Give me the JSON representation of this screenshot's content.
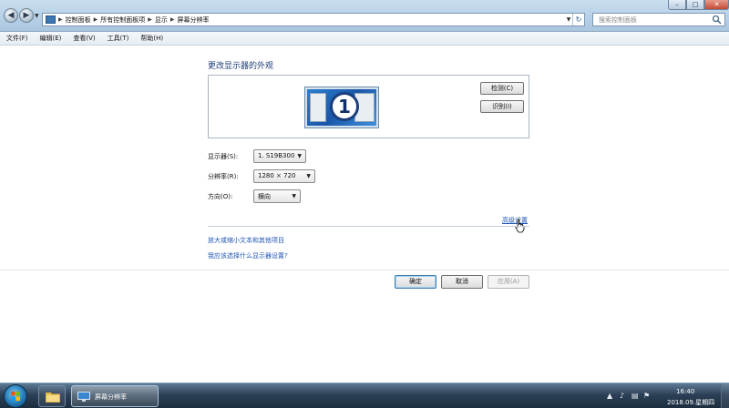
{
  "address_bar": {
    "breadcrumbs": [
      "控制面板",
      "所有控制面板项",
      "显示",
      "屏幕分辨率"
    ]
  },
  "search": {
    "placeholder": "搜索控制面板"
  },
  "menu": {
    "items": [
      "文件(F)",
      "编辑(E)",
      "查看(V)",
      "工具(T)",
      "帮助(H)"
    ]
  },
  "main": {
    "title": "更改显示器的外观",
    "monitor_number": "1",
    "detect_label": "检测(C)",
    "identify_label": "识别(I)",
    "display_label": "显示器(S):",
    "display_value": "1. S19B300",
    "resolution_label": "分辨率(R):",
    "resolution_value": "1280 × 720",
    "orientation_label": "方向(O):",
    "orientation_value": "横向",
    "advanced_link": "高级设置",
    "text_size_link": "放大或缩小文本和其他项目",
    "which_settings_link": "我应该选择什么显示器设置?"
  },
  "buttons": {
    "ok": "确定",
    "cancel": "取消",
    "apply": "应用(A)"
  },
  "taskbar": {
    "active_window_label": "屏幕分辨率",
    "clock_time": "16:40",
    "clock_date": "2018.09.星期四"
  }
}
